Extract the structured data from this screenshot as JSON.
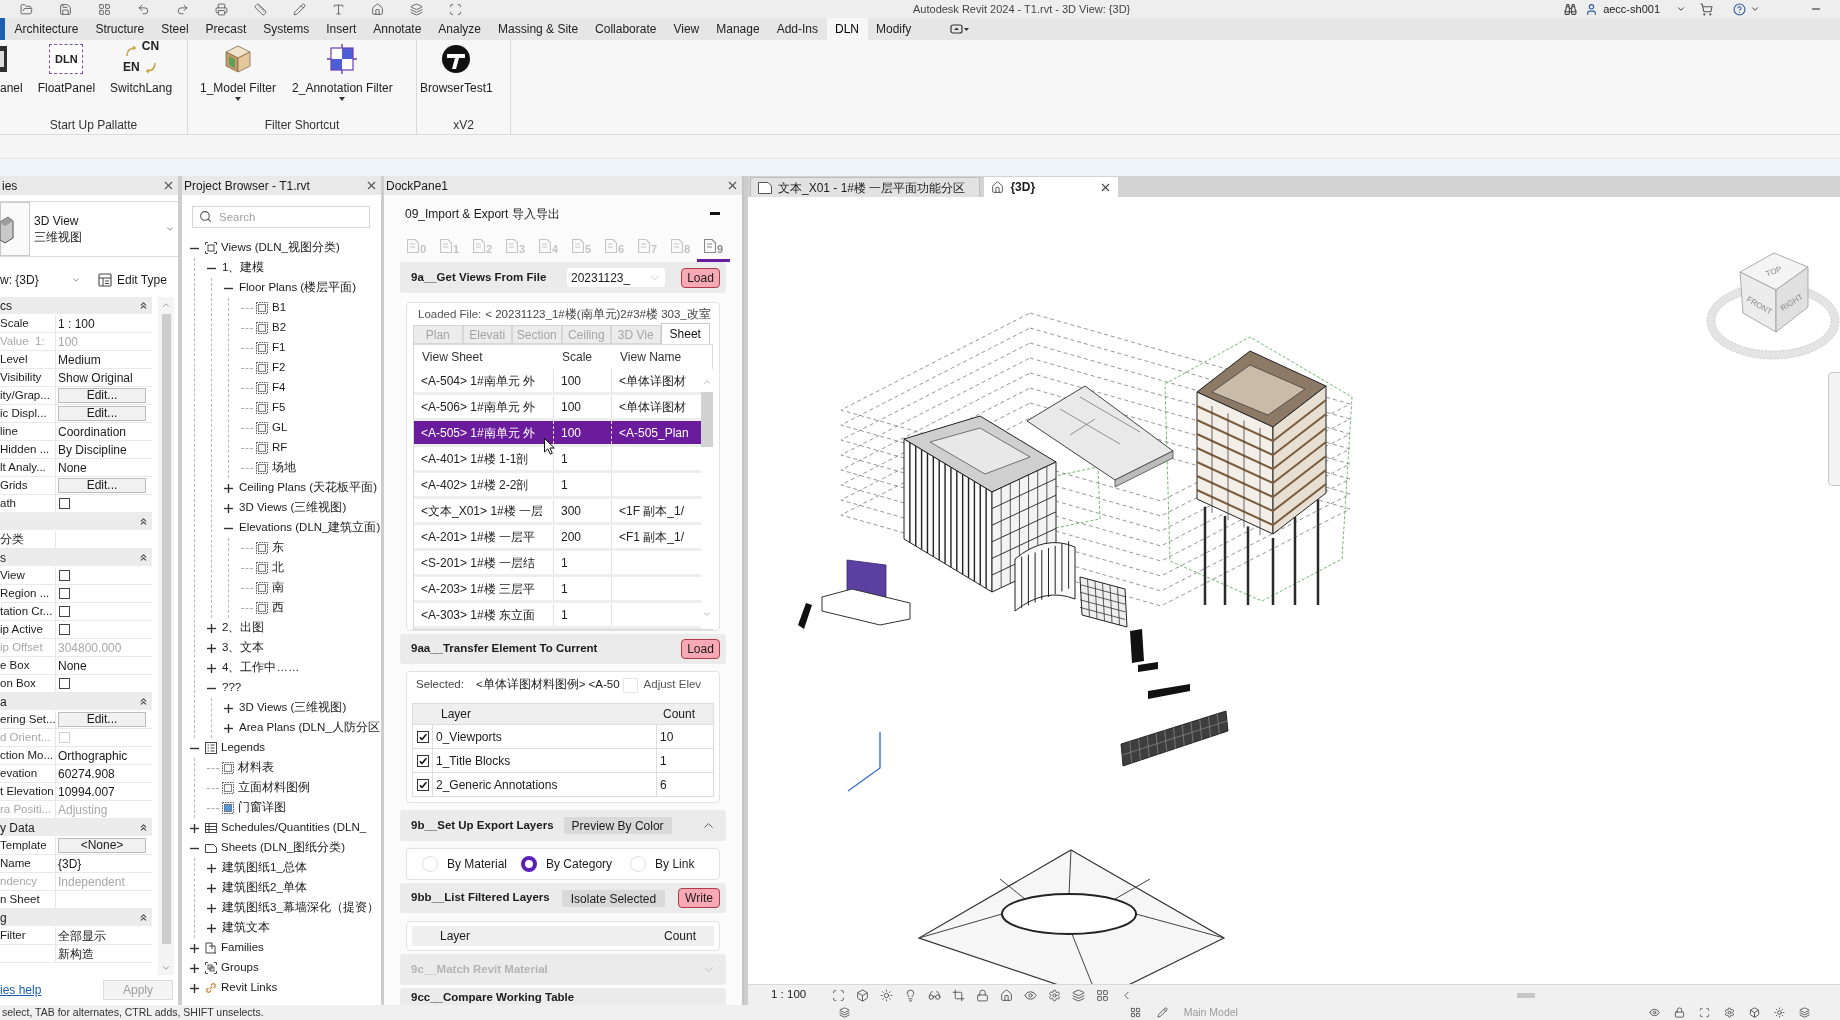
{
  "title_bar": {
    "title": "Autodesk Revit 2024 - T1.rvt - 3D View: {3D}",
    "user": "aecc-sh001"
  },
  "ribbon": {
    "tabs": [
      {
        "label": "Architecture",
        "selected": false
      },
      {
        "label": "Structure",
        "selected": false
      },
      {
        "label": "Steel",
        "selected": false
      },
      {
        "label": "Precast",
        "selected": false
      },
      {
        "label": "Systems",
        "selected": false
      },
      {
        "label": "Insert",
        "selected": false
      },
      {
        "label": "Annotate",
        "selected": false
      },
      {
        "label": "Analyze",
        "selected": false
      },
      {
        "label": "Massing & Site",
        "selected": false
      },
      {
        "label": "Collaborate",
        "selected": false
      },
      {
        "label": "View",
        "selected": false
      },
      {
        "label": "Manage",
        "selected": false
      },
      {
        "label": "Add-Ins",
        "selected": false
      },
      {
        "label": "DLN",
        "selected": true
      },
      {
        "label": "Modify",
        "selected": false
      }
    ],
    "panels": [
      {
        "title": "Start Up Pallatte",
        "buttons": [
          {
            "label": "anel",
            "kind": "panel",
            "dropdown": false
          },
          {
            "label": "FloatPanel",
            "kind": "logo",
            "icon_text": "DLN",
            "dropdown": false
          },
          {
            "label": "SwitchLang",
            "kind": "language",
            "icon_texts": [
              "CN",
              "EN"
            ],
            "dropdown": false
          }
        ]
      },
      {
        "title": "Filter Shortcut",
        "buttons": [
          {
            "label": "1_Model Filter",
            "kind": "model",
            "dropdown": true
          },
          {
            "label": "2_Annotation Filter",
            "kind": "annotation",
            "dropdown": true
          }
        ]
      },
      {
        "title": "xV2",
        "buttons": [
          {
            "label": "BrowserTest1",
            "kind": "browser",
            "dropdown": false
          }
        ]
      }
    ]
  },
  "properties": {
    "title": "ies",
    "type_lines": [
      "3D View",
      "三维视图"
    ],
    "view_selector": "w: {3D}",
    "edit_type": "Edit Type",
    "rows": [
      {
        "kind": "section",
        "label": "cs"
      },
      {
        "kind": "text",
        "label": "Scale",
        "value": "1 : 100",
        "disabled": false
      },
      {
        "kind": "text",
        "label": "Value  1:",
        "value": "100",
        "disabled": true
      },
      {
        "kind": "text",
        "label": "Level",
        "value": "Medium",
        "disabled": false
      },
      {
        "kind": "text",
        "label": "Visibility",
        "value": "Show Original",
        "disabled": false
      },
      {
        "kind": "button",
        "label": "ity/Grap...",
        "value": "Edit...",
        "disabled": false
      },
      {
        "kind": "button",
        "label": "ic Displ...",
        "value": "Edit...",
        "disabled": false
      },
      {
        "kind": "text",
        "label": "line",
        "value": "Coordination",
        "disabled": false
      },
      {
        "kind": "text",
        "label": "Hidden ...",
        "value": "By Discipline",
        "disabled": false
      },
      {
        "kind": "text",
        "label": "lt Analy...",
        "value": "None",
        "disabled": false
      },
      {
        "kind": "button",
        "label": "Grids",
        "value": "Edit...",
        "disabled": false
      },
      {
        "kind": "checkbox",
        "label": "ath",
        "checked": false,
        "disabled": false
      },
      {
        "kind": "section"
      },
      {
        "kind": "text",
        "label": "分类",
        "disabled": false
      },
      {
        "kind": "section",
        "label": "s"
      },
      {
        "kind": "checkbox",
        "label": "View",
        "checked": false,
        "disabled": false
      },
      {
        "kind": "checkbox",
        "label": "Region ...",
        "checked": false,
        "disabled": false
      },
      {
        "kind": "checkbox",
        "label": "tation Cr...",
        "checked": false,
        "disabled": false
      },
      {
        "kind": "checkbox",
        "label": "ip Active",
        "checked": false,
        "disabled": false
      },
      {
        "kind": "text",
        "label": "ip Offset",
        "value": "304800.000",
        "disabled": true
      },
      {
        "kind": "text",
        "label": "e Box",
        "value": "None",
        "disabled": false
      },
      {
        "kind": "checkbox",
        "label": "on Box",
        "checked": false,
        "disabled": false
      },
      {
        "kind": "section",
        "label": "a"
      },
      {
        "kind": "button",
        "label": "ering Set...",
        "value": "Edit...",
        "disabled": false
      },
      {
        "kind": "checkbox",
        "label": "d Orient...",
        "checked": false,
        "disabled": true
      },
      {
        "kind": "text",
        "label": "ction Mo...",
        "value": "Orthographic",
        "disabled": false
      },
      {
        "kind": "text",
        "label": "evation",
        "value": "60274.908",
        "disabled": false
      },
      {
        "kind": "text",
        "label": "t Elevation",
        "value": "10994.007",
        "disabled": false
      },
      {
        "kind": "text",
        "label": "ra Positi...",
        "value": "Adjusting",
        "disabled": true
      },
      {
        "kind": "section",
        "label": "y Data"
      },
      {
        "kind": "button",
        "label": "Template",
        "value": "<None>",
        "disabled": false
      },
      {
        "kind": "text",
        "label": "Name",
        "value": "{3D}",
        "disabled": false
      },
      {
        "kind": "text",
        "label": "ndency",
        "value": "Independent",
        "disabled": true
      },
      {
        "kind": "text",
        "label": "n Sheet",
        "disabled": false
      },
      {
        "kind": "section",
        "label": "g"
      },
      {
        "kind": "text",
        "label": "Filter",
        "value": "全部显示",
        "disabled": false
      },
      {
        "kind": "text",
        "value": "新构造",
        "disabled": false
      }
    ],
    "help": "ies help",
    "apply": {
      "label": "Apply",
      "disabled": true
    }
  },
  "project_browser": {
    "title": "Project Browser - T1.rvt",
    "search_placeholder": "Search",
    "tree": [
      {
        "label": "Views (DLN_视图分类)",
        "kind": "views",
        "expanded": true,
        "children": [
          {
            "label": "1、建模",
            "expanded": true,
            "children": [
              {
                "label": "Floor Plans (楼层平面)",
                "expanded": true,
                "children": [
                  {
                    "label": "B1",
                    "kind": "view"
                  },
                  {
                    "label": "B2",
                    "kind": "view"
                  },
                  {
                    "label": "F1",
                    "kind": "view"
                  },
                  {
                    "label": "F2",
                    "kind": "view"
                  },
                  {
                    "label": "F4",
                    "kind": "view"
                  },
                  {
                    "label": "F5",
                    "kind": "view"
                  },
                  {
                    "label": "GL",
                    "kind": "view"
                  },
                  {
                    "label": "RF",
                    "kind": "view"
                  },
                  {
                    "label": "场地",
                    "kind": "view"
                  }
                ]
              },
              {
                "label": "Ceiling Plans (天花板平面)",
                "expanded": false
              },
              {
                "label": "3D Views (三维视图)",
                "expanded": false
              },
              {
                "label": "Elevations (DLN_建筑立面)",
                "expanded": true,
                "children": [
                  {
                    "label": "东",
                    "kind": "view"
                  },
                  {
                    "label": "北",
                    "kind": "view"
                  },
                  {
                    "label": "南",
                    "kind": "view"
                  },
                  {
                    "label": "西",
                    "kind": "view"
                  }
                ]
              }
            ]
          },
          {
            "label": "2、出图",
            "expanded": false
          },
          {
            "label": "3、文本",
            "expanded": false
          },
          {
            "label": "4、工作中……",
            "expanded": false
          },
          {
            "label": "???",
            "expanded": true,
            "children": [
              {
                "label": "3D Views (三维视图)",
                "expanded": false
              },
              {
                "label": "Area Plans (DLN_人防分区",
                "expanded": false
              }
            ]
          }
        ]
      },
      {
        "label": "Legends",
        "kind": "legends",
        "expanded": true,
        "children": [
          {
            "label": "材料表",
            "kind": "view"
          },
          {
            "label": "立面材料图例",
            "kind": "view"
          },
          {
            "label": "门窗详图",
            "kind": "active"
          }
        ]
      },
      {
        "label": "Schedules/Quantities (DLN_",
        "kind": "schedules",
        "expanded": false
      },
      {
        "label": "Sheets (DLN_图纸分类)",
        "kind": "sheets",
        "expanded": true,
        "children": [
          {
            "label": "建筑图纸1_总体",
            "expanded": false
          },
          {
            "label": "建筑图纸2_单体",
            "expanded": false
          },
          {
            "label": "建筑图纸3_幕墙深化（提资）",
            "expanded": false
          },
          {
            "label": "建筑文本",
            "expanded": false
          }
        ]
      },
      {
        "label": "Families",
        "kind": "families",
        "expanded": false
      },
      {
        "label": "Groups",
        "kind": "groups",
        "expanded": false
      },
      {
        "label": "Revit Links",
        "kind": "links",
        "expanded": false
      }
    ]
  },
  "dock_pane": {
    "title": "DockPane1",
    "heading": "09_Import & Export 导入导出",
    "tool_tabs": [
      {
        "label": "0",
        "selected": false
      },
      {
        "label": "1",
        "selected": false
      },
      {
        "label": "2",
        "selected": false
      },
      {
        "label": "3",
        "selected": false
      },
      {
        "label": "4",
        "selected": false
      },
      {
        "label": "5",
        "selected": false
      },
      {
        "label": "6",
        "selected": false
      },
      {
        "label": "7",
        "selected": false
      },
      {
        "label": "8",
        "selected": false
      },
      {
        "label": "9",
        "selected": true
      }
    ],
    "sections": [
      {
        "kind": "views",
        "title": "9a__Get Views From File",
        "combo": "20231123_",
        "button": "Load",
        "loaded_label": "Loaded File:",
        "loaded_file": "< 20231123_1#楼(南单元)2#3#楼 303_改室",
        "tabs": [
          {
            "label": "Plan",
            "selected": false
          },
          {
            "label": "Elevati",
            "selected": false
          },
          {
            "label": "Section",
            "selected": false
          },
          {
            "label": "Ceiling",
            "selected": false
          },
          {
            "label": "3D Vie",
            "selected": false
          },
          {
            "label": "Sheet",
            "selected": true
          }
        ],
        "columns": [
          "View Sheet",
          "Scale",
          "View Name"
        ],
        "rows": [
          {
            "cells": [
              "<A-504> 1#南单元 外",
              "100",
              "<单体详图材"
            ],
            "selected": false
          },
          {
            "cells": [
              "<A-506> 1#南单元 外",
              "100",
              "<单体详图材"
            ],
            "selected": false
          },
          {
            "cells": [
              "<A-505> 1#南单元 外",
              "100",
              "<A-505_Plan"
            ],
            "selected": true
          },
          {
            "cells": [
              "<A-401> 1#楼 1-1剖",
              "1"
            ],
            "selected": false
          },
          {
            "cells": [
              "<A-402> 1#楼 2-2剖",
              "1"
            ],
            "selected": false
          },
          {
            "cells": [
              "<文本_X01> 1#楼 一层",
              "300",
              "<1F 副本_1/"
            ],
            "selected": false
          },
          {
            "cells": [
              "<A-201> 1#楼 一层平",
              "200",
              "<F1 副本_1/"
            ],
            "selected": false
          },
          {
            "cells": [
              "<S-201> 1#楼 一层结",
              "1"
            ],
            "selected": false
          },
          {
            "cells": [
              "<A-203> 1#楼 三层平",
              "1"
            ],
            "selected": false
          },
          {
            "cells": [
              "<A-303> 1#楼 东立面",
              "1"
            ],
            "selected": false
          }
        ]
      },
      {
        "kind": "transfer",
        "title": "9aa__Transfer Element To Current",
        "button": "Load",
        "selected_label": "Selected:",
        "selected_value": "<单体详图材料图例> <A-50",
        "adjust_checked": false,
        "adjust_label": "Adjust Elev",
        "columns": [
          "Layer",
          "Count"
        ],
        "layers": [
          {
            "name": "0_Viewports",
            "count": "10",
            "checked": true
          },
          {
            "name": "1_Title Blocks",
            "count": "1",
            "checked": true
          },
          {
            "name": "2_Generic Annotations",
            "count": "6",
            "checked": true
          }
        ]
      },
      {
        "kind": "export",
        "title": "9b__Set Up Export Layers",
        "action": "Preview By Color",
        "expanded": true,
        "options": [
          {
            "label": "By Material",
            "selected": false
          },
          {
            "label": "By Category",
            "selected": true
          },
          {
            "label": "By Link",
            "selected": false
          }
        ]
      },
      {
        "kind": "filtered",
        "title": "9bb__List Filtered Layers",
        "action": "Isolate Selected",
        "button": "Write",
        "columns": [
          "Layer",
          "Count"
        ]
      },
      {
        "kind": "collapsed",
        "title": "9c__Match Revit Material",
        "expanded": false,
        "disabled": true
      },
      {
        "kind": "compare",
        "title": "9cc__Compare Working Table"
      }
    ]
  },
  "view": {
    "tabs": [
      {
        "label": "文本_X01 - 1#楼 一层平面功能分区",
        "kind": "sheet",
        "selected": false
      },
      {
        "label": "{3D}",
        "kind": "model",
        "selected": true
      }
    ],
    "view_cube": [
      "TOP",
      "FRONT",
      "RIGHT"
    ],
    "scale": "1 : 100"
  },
  "status_bar": {
    "hint": "select, TAB for alternates, CTRL adds, SHIFT unselects.",
    "model": "Main Model"
  }
}
